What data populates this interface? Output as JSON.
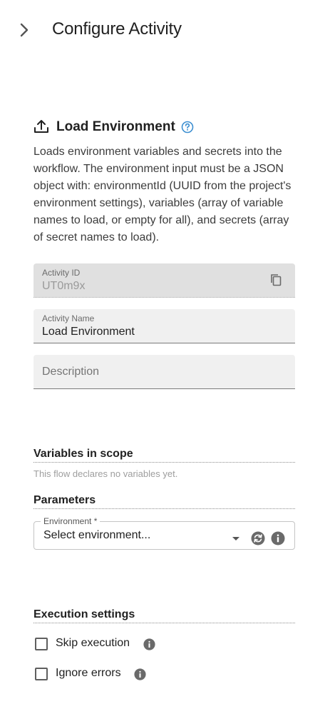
{
  "header": {
    "title": "Configure Activity",
    "collapse_icon": "chevron-right-icon"
  },
  "activity": {
    "title": "Load Environment",
    "icon": "upload-icon",
    "help_icon": "help-circle-icon",
    "description": "Loads environment variables and secrets into the workflow. The environment input must be a JSON object with: environmentId (UUID from the project's environment settings), variables (array of variable names to load, or empty for all), and secrets (array of secret names to load)."
  },
  "fields": {
    "activity_id": {
      "label": "Activity ID",
      "value": "UT0m9x",
      "disabled": true
    },
    "activity_name": {
      "label": "Activity Name",
      "value": "Load Environment"
    },
    "description": {
      "placeholder": "Description"
    }
  },
  "variables": {
    "title": "Variables in scope",
    "empty_text": "This flow declares no variables yet."
  },
  "parameters": {
    "title": "Parameters",
    "environment": {
      "label": "Environment *",
      "value": "Select environment..."
    }
  },
  "execution": {
    "title": "Execution settings",
    "skip_label": "Skip execution",
    "skip_checked": false,
    "ignore_label": "Ignore errors",
    "ignore_checked": false
  },
  "colors": {
    "accent": "#3d8fd1",
    "field_bg": "#f0f0f0",
    "disabled_bg": "#e0e0e0",
    "icon_dark": "#6a6a6a"
  }
}
